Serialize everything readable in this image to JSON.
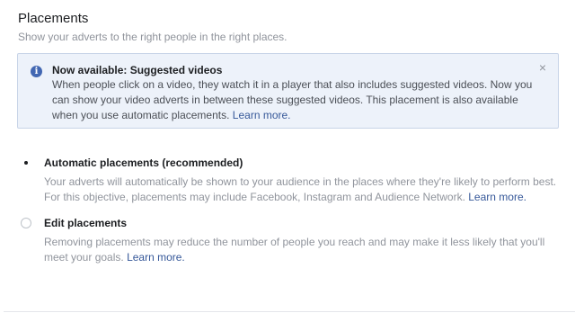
{
  "section": {
    "title": "Placements",
    "subtitle": "Show your adverts to the right people in the right places."
  },
  "notice": {
    "icon": "info-icon",
    "title": "Now available: Suggested videos",
    "body": "When people click on a video, they watch it in a player that also includes suggested videos. Now you can show your video adverts in between these suggested videos. This placement is also available when you use automatic placements.",
    "link": "Learn more.",
    "close": "×"
  },
  "options": [
    {
      "label": "Automatic placements (recommended)",
      "selected": true,
      "description": "Your adverts will automatically be shown to your audience in the places where they're likely to perform best. For this objective, placements may include Facebook, Instagram and Audience Network.",
      "link": "Learn more."
    },
    {
      "label": "Edit placements",
      "selected": false,
      "description": "Removing placements may reduce the number of people you reach and may make it less likely that you'll meet your goals.",
      "link": "Learn more."
    }
  ],
  "colors": {
    "accent": "#4267b2",
    "link": "#365899",
    "notice_bg": "#edf2fa"
  }
}
